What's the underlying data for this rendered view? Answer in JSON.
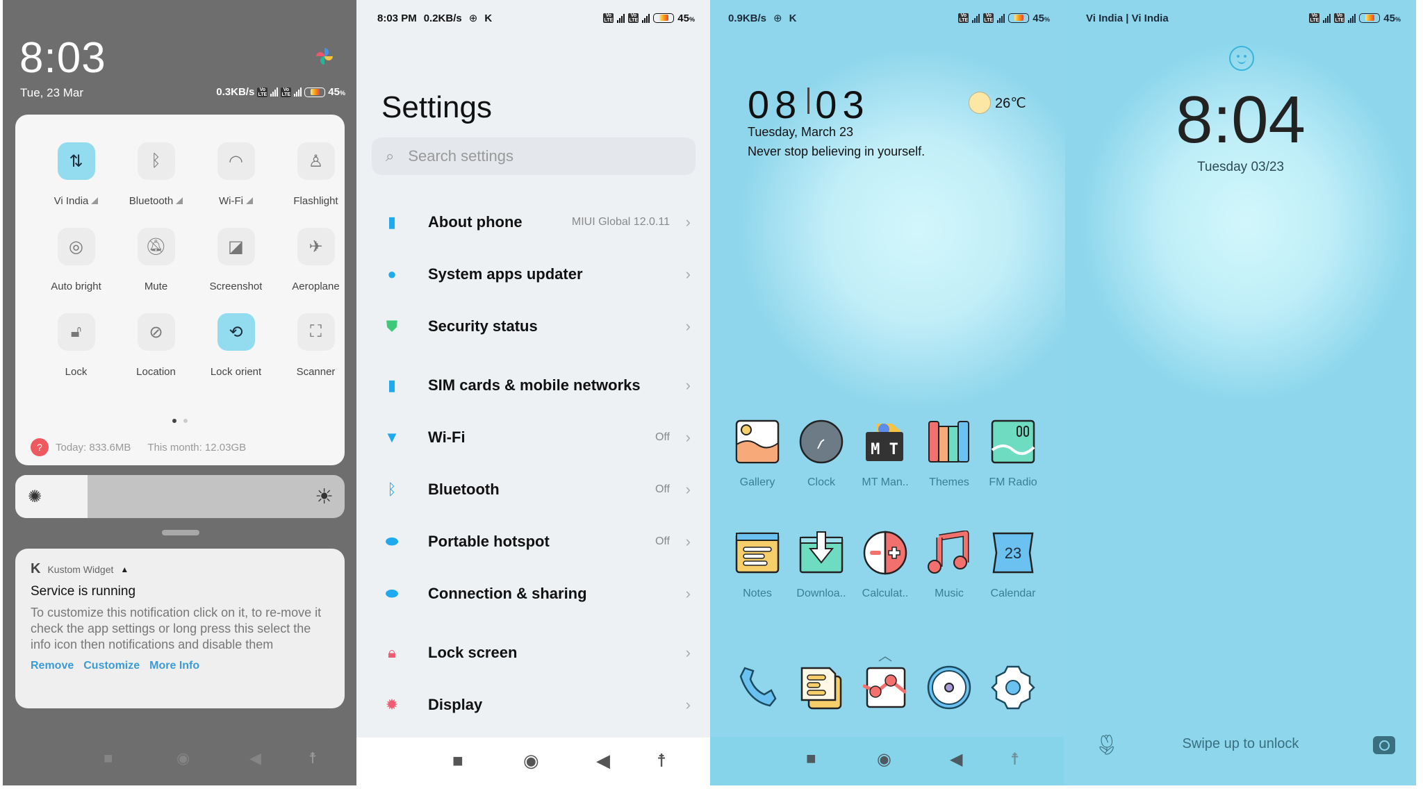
{
  "status_common": {
    "battery_pct": "45",
    "battery_pct_suffix": "%"
  },
  "panel1": {
    "time": "8:03",
    "date": "Tue, 23 Mar",
    "net_speed": "0.3KB/s",
    "toggles": [
      {
        "label": "Vi India",
        "icon": "mobile-data-icon",
        "on": true,
        "expandable": true
      },
      {
        "label": "Bluetooth",
        "icon": "bluetooth-icon",
        "on": false,
        "expandable": true
      },
      {
        "label": "Wi-Fi",
        "icon": "wifi-icon",
        "on": false,
        "expandable": true
      },
      {
        "label": "Flashlight",
        "icon": "flashlight-icon",
        "on": false
      },
      {
        "label": "Auto bright",
        "icon": "auto-brightness-icon",
        "on": false
      },
      {
        "label": "Mute",
        "icon": "mute-icon",
        "on": false
      },
      {
        "label": "Screenshot",
        "icon": "screenshot-icon",
        "on": false
      },
      {
        "label": "Aeroplane",
        "icon": "aeroplane-icon",
        "on": false
      },
      {
        "label": "Lock",
        "icon": "lock-icon",
        "on": false
      },
      {
        "label": "Location",
        "icon": "location-icon",
        "on": false
      },
      {
        "label": "Lock orient",
        "icon": "rotation-lock-icon",
        "on": true
      },
      {
        "label": "Scanner",
        "icon": "scanner-icon",
        "on": false
      }
    ],
    "page_dots": {
      "count": 2,
      "active": 0
    },
    "usage": {
      "today": "Today: 833.6MB",
      "month": "This month: 12.03GB",
      "badge": "?"
    },
    "brightness_fraction": 0.22,
    "notification": {
      "app": "Kustom Widget",
      "title": "Service is running",
      "body": "To customize this notification click on it, to re-move it check the app settings or long press this select the info icon then notifications and disable them",
      "actions": [
        "Remove",
        "Customize",
        "More Info"
      ]
    }
  },
  "panel2": {
    "time": "8:03 PM",
    "net_speed": "0.2KB/s",
    "title": "Settings",
    "search_placeholder": "Search settings",
    "items": [
      {
        "label": "About phone",
        "value": "MIUI Global 12.0.11",
        "icon": "phone-info-icon",
        "color": "#1fa9ee"
      },
      {
        "label": "System apps updater",
        "value": "",
        "icon": "update-icon",
        "color": "#1fa9ee"
      },
      {
        "label": "Security status",
        "value": "",
        "icon": "shield-check-icon",
        "color": "#3ec97a"
      },
      {
        "label": "SIM cards & mobile networks",
        "value": "",
        "icon": "sim-card-icon",
        "color": "#1fa9ee"
      },
      {
        "label": "Wi-Fi",
        "value": "Off",
        "icon": "wifi-icon",
        "color": "#1fa9ee"
      },
      {
        "label": "Bluetooth",
        "value": "Off",
        "icon": "bluetooth-icon",
        "color": "#1fa9ee"
      },
      {
        "label": "Portable hotspot",
        "value": "Off",
        "icon": "hotspot-icon",
        "color": "#1fa9ee"
      },
      {
        "label": "Connection & sharing",
        "value": "",
        "icon": "connection-icon",
        "color": "#1fa9ee"
      },
      {
        "label": "Lock screen",
        "value": "",
        "icon": "padlock-icon",
        "color": "#ef5b73"
      },
      {
        "label": "Display",
        "value": "",
        "icon": "display-icon",
        "color": "#ef5b73"
      }
    ]
  },
  "panel3": {
    "net_speed": "0.9KB/s",
    "clock_hours": "08",
    "clock_minutes": "03",
    "date": "Tuesday, March 23",
    "quote": "Never stop believing in yourself.",
    "temperature": "26℃",
    "apps": [
      "Gallery",
      "Clock",
      "MT Man..",
      "Themes",
      "FM Radio",
      "Notes",
      "Downloa..",
      "Calculat..",
      "Music",
      "Calendar"
    ],
    "calendar_day": "23",
    "dock": [
      "Phone",
      "Messages",
      "Browser",
      "Camera",
      "Settings"
    ]
  },
  "panel4": {
    "carrier": "Vi India | Vi India",
    "time": "8:04",
    "date": "Tuesday 03/23",
    "unlock_hint": "Swipe up to unlock"
  }
}
